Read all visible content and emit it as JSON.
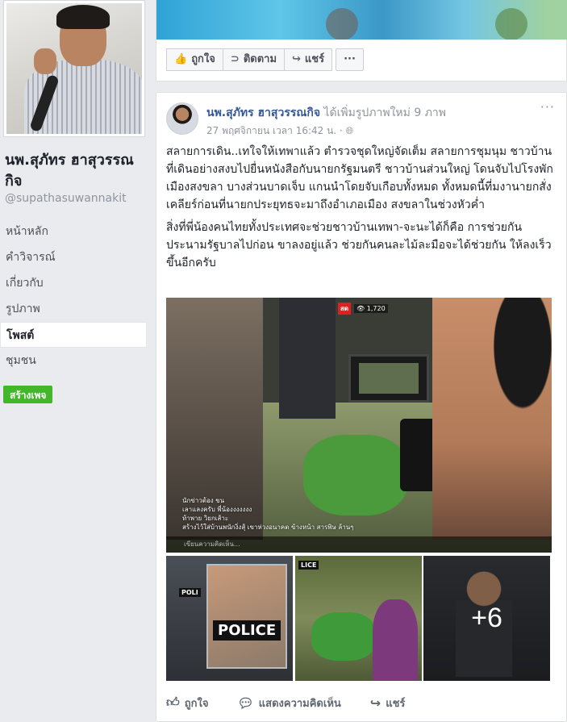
{
  "profile": {
    "name": "นพ.สุภัทร ฮาสุวรรณกิจ",
    "handle": "@supathasuwannakit"
  },
  "nav": {
    "items": [
      {
        "label": "หน้าหลัก",
        "active": false
      },
      {
        "label": "คำวิจารณ์",
        "active": false
      },
      {
        "label": "เกี่ยวกับ",
        "active": false
      },
      {
        "label": "รูปภาพ",
        "active": false
      },
      {
        "label": "โพสต์",
        "active": true
      },
      {
        "label": "ชุมชน",
        "active": false
      }
    ],
    "create_page_label": "สร้างเพจ"
  },
  "prev_post_actions": {
    "like": "ถูกใจ",
    "follow": "ติดตาม",
    "share": "แชร์",
    "more": "···"
  },
  "post": {
    "author": "นพ.สุภัทร ฮาสุวรรณกิจ",
    "action_text": "ได้เพิ่มรูปภาพใหม่ 9 ภาพ",
    "timestamp": "27 พฤศจิกายน เวลา 16:42 น. · ",
    "menu": "···",
    "paragraph1": "สลายการเดิน..เทใจให้เทพาแล้ว ตำรวจชุดใหญ่จัดเต็ม สลายการชุมนุม ชาวบ้านที่เดินอย่างสงบไปยื่นหนังสือกับนายกรัฐมนตรี ชาวบ้านส่วนใหญ่ โดนจับไปโรงพักเมืองสงขลา บางส่วนบาดเจ็บ แกนนำโดยจับเกือบทั้งหมด ทั้งหมดนี้ที่มงานายกสั่งเคลียร์ก่อนที่นายกประยุทธจะมาถึงอำเภอเมือง สงขลาในช่วงหัวค่ำ",
    "paragraph2": "สิ่งที่พี่น้องคนไทยทั้งประเทศจะช่วยชาวบ้านเทพา-จะนะได้ก็คือ การช่วยกันประนามรัฐบาลไปก่อน ขาลงอยู่แล้ว ช่วยกันคนละไม้ละมือจะได้ช่วยกัน ให้ลงเร็วขึ้นอีกครับ",
    "photo_live_badge": "สด",
    "photo_viewers": "👁 1,720",
    "photo_overlay_line1": "นักข่าวต้อง ขน",
    "photo_overlay_line2": "เลาแลงครับ พี่น้องงงงงงง",
    "photo_overlay_line3": "ท้าพาย วิยกเส้าะ",
    "photo_overlay_line4": "สร้างไว้ใส่บ้านพนักงิ่งสุ้ เขาห่วงอนาคต ข้างหน้า สารพิษ ล้านๆ",
    "photo_comment_placeholder": "เขียนความคิดเห็น...",
    "thumb_police_large": "POLICE",
    "thumb_police_small": "POLI",
    "thumb_police_small2": "LICE",
    "more_photos": "+6",
    "actions": {
      "like": "ถูกใจ",
      "comment": "แสดงความคิดเห็น",
      "share": "แชร์"
    }
  },
  "colors": {
    "link": "#365899",
    "muted": "#90949c",
    "green_button": "#42b72a",
    "background": "#e9ebee"
  }
}
